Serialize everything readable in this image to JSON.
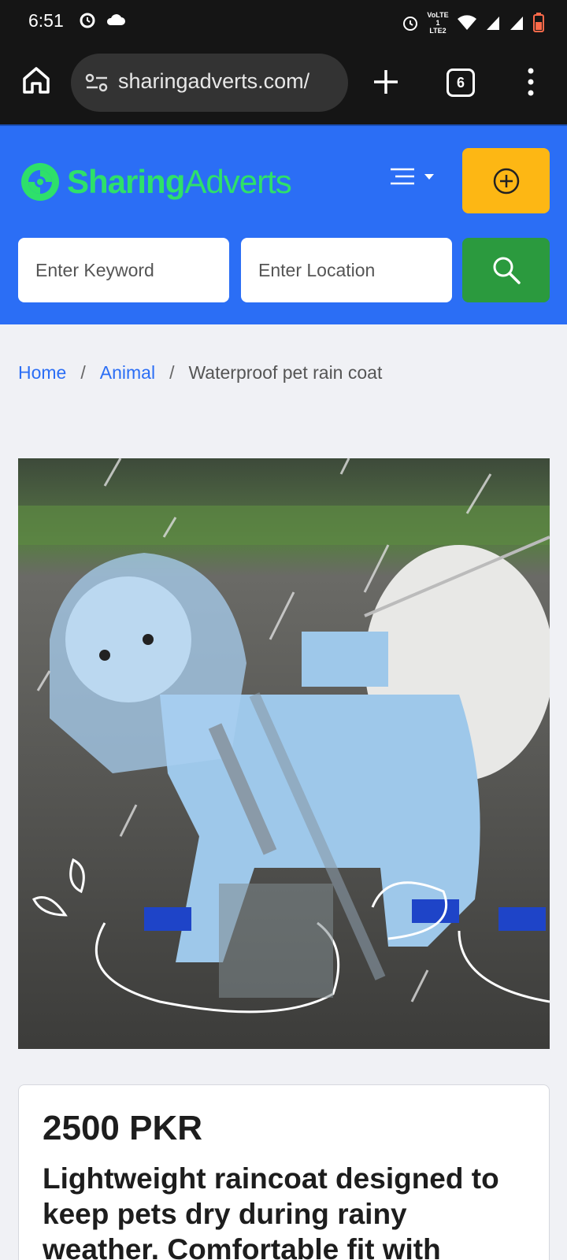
{
  "status_bar": {
    "time": "6:51",
    "network": "VoLTE 1 LTE2"
  },
  "browser": {
    "url": "sharingadverts.com/",
    "tab_count": "6"
  },
  "header": {
    "logo_part1": "Sharing",
    "logo_part2": "Adverts",
    "keyword_placeholder": "Enter Keyword",
    "location_placeholder": "Enter Location",
    "brand_color": "#2b6ef5",
    "post_color": "#fdb714",
    "search_color": "#2b9a3e"
  },
  "breadcrumb": {
    "home": "Home",
    "category": "Animal",
    "current": "Waterproof pet rain coat"
  },
  "listing": {
    "price": "2500 PKR",
    "description": "Lightweight raincoat designed to keep pets dry during rainy weather. Comfortable fit with"
  }
}
